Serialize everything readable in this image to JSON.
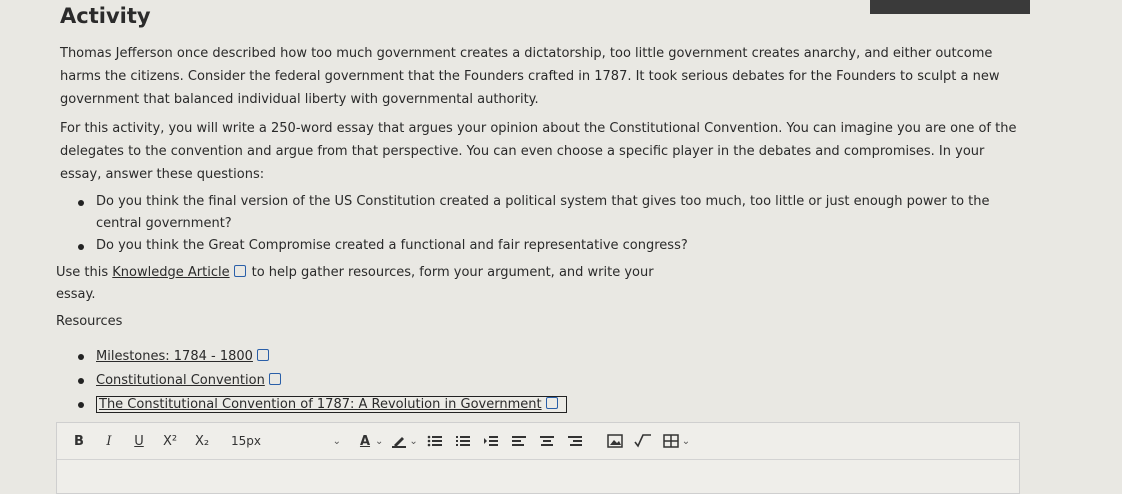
{
  "title": "Activity",
  "paragraphs": {
    "p1": "Thomas Jefferson once described how too much government creates a dictatorship, too little government creates anarchy, and either outcome harms the citizens. Consider the federal government that the Founders crafted in 1787. It took serious debates for the Founders to sculpt a new government that balanced individual liberty with governmental authority.",
    "p2": "For this activity, you will write a 250-word essay that argues your opinion about the Constitutional Convention. You can imagine you are one of the delegates to the convention and argue from that perspective. You can even choose a specific player in the debates and compromises. In your essay, answer these questions:"
  },
  "questions": [
    "Do you think the final version of the US Constitution created a political system that gives too much, too little or just enough power to the central government?",
    "Do you think the Great Compromise created a functional and fair representative congress?"
  ],
  "use_line": {
    "prefix": "Use this",
    "link": "Knowledge Article",
    "suffix": "to help gather resources, form your argument, and write your essay."
  },
  "resources": {
    "heading": "Resources",
    "items": [
      "Milestones: 1784 - 1800",
      "Constitutional Convention",
      "The Constitutional Convention of 1787: A Revolution in Government"
    ]
  },
  "editor": {
    "bold": "B",
    "italic": "I",
    "underline": "U",
    "superscript": "X²",
    "subscript": "X₂",
    "font_size": "15px",
    "font_color": "A",
    "icons": [
      "bold-icon",
      "italic-icon",
      "underline-icon",
      "superscript-icon",
      "subscript-icon",
      "font-color-icon",
      "highlight-icon",
      "bullet-list-icon",
      "numbered-list-icon",
      "indent-icon",
      "align-left-icon",
      "align-center-icon",
      "align-right-icon",
      "image-icon",
      "formula-icon",
      "table-icon"
    ]
  }
}
